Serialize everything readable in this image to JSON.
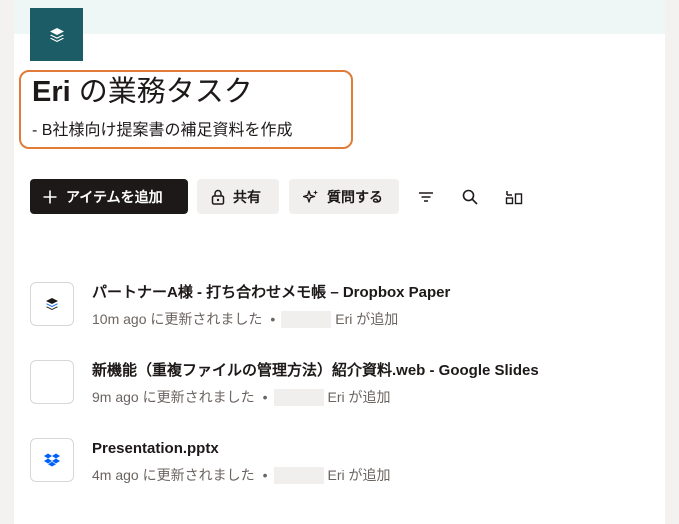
{
  "header": {
    "title_owner": "Eri",
    "title_rest": " の業務タスク",
    "subtitle": "- B社様向け提案書の補足資料を作成"
  },
  "toolbar": {
    "add_label": "アイテムを追加",
    "share_label": "共有",
    "ask_label": "質問する"
  },
  "files": [
    {
      "name": "パートナーA様 - 打ち合わせメモ帳 – Dropbox Paper",
      "time": "10m ago に更新されました",
      "dot": "•",
      "added_by": "Eri が追加",
      "icon": "dropbox-paper-icon"
    },
    {
      "name": "新機能（重複ファイルの管理方法）紹介資料.web - Google Slides",
      "time": "9m ago に更新されました",
      "dot": "•",
      "added_by": "Eri が追加",
      "icon": "blank-file-icon"
    },
    {
      "name": "Presentation.pptx",
      "time": "4m ago に更新されました",
      "dot": "•",
      "added_by": "Eri が追加",
      "icon": "dropbox-icon"
    }
  ],
  "colors": {
    "app_tile": "#1c5c66",
    "title_outline": "#e07b39",
    "primary_button": "#1e1919",
    "dropbox_blue": "#0061fe"
  }
}
